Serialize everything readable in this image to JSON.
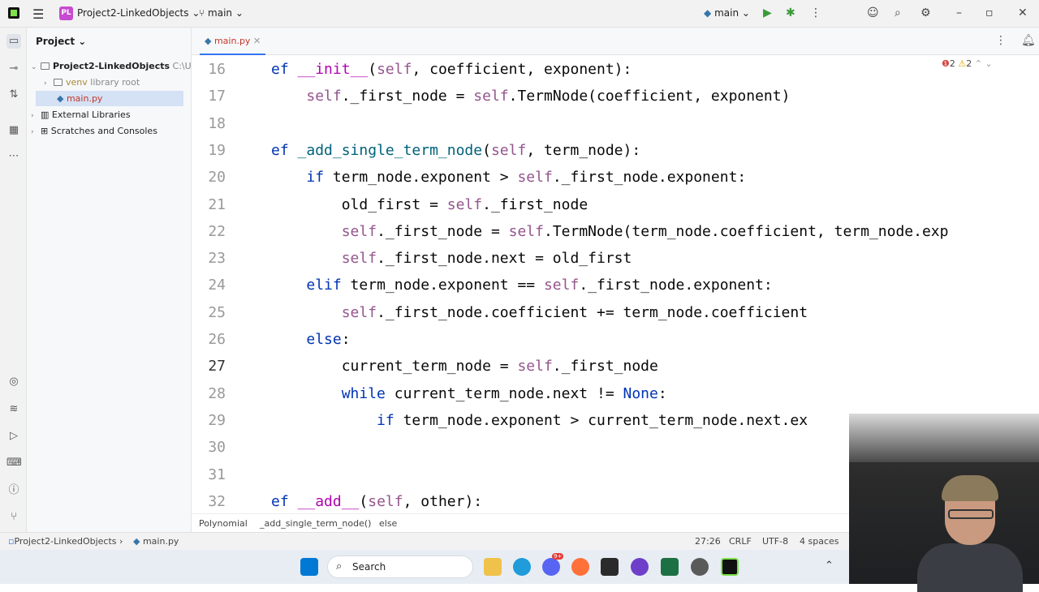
{
  "titlebar": {
    "project_badge": "PL",
    "project_name": "Project2-LinkedObjects",
    "branch": "main",
    "run_config": "main"
  },
  "sidebar": {
    "header": "Project",
    "tree": [
      {
        "label": "Project2-LinkedObjects",
        "path": "C:\\Us"
      },
      {
        "label": "venv",
        "note": "library root"
      },
      {
        "label": "main.py"
      },
      {
        "label": "External Libraries"
      },
      {
        "label": "Scratches and Consoles"
      }
    ]
  },
  "tabs": [
    {
      "label": "main.py"
    }
  ],
  "inspections": {
    "errors": "2",
    "warnings": "2"
  },
  "editor": {
    "line_numbers": [
      "16",
      "17",
      "18",
      "19",
      "20",
      "21",
      "22",
      "23",
      "24",
      "25",
      "26",
      "27",
      "28",
      "29",
      "30",
      "31",
      "32"
    ],
    "lines": [
      "ef __init__(self, coefficient, exponent):",
      "    self._first_node = self.TermNode(coefficient, exponent)",
      "",
      "ef _add_single_term_node(self, term_node):",
      "    if term_node.exponent > self._first_node.exponent:",
      "        old_first = self._first_node",
      "        self._first_node = self.TermNode(term_node.coefficient, term_node.exp",
      "        self._first_node.next = old_first",
      "    elif term_node.exponent == self._first_node.exponent:",
      "        self._first_node.coefficient += term_node.coefficient",
      "    else:",
      "        current_term_node = self._first_node",
      "        while current_term_node.next != None:",
      "            if term_node.exponent > current_term_node.next.ex",
      "",
      "",
      "ef __add__(self, other):"
    ]
  },
  "breadcrumb": [
    "Polynomial",
    "_add_single_term_node()",
    "else"
  ],
  "status": {
    "path_project": "Project2-LinkedObjects",
    "path_file": "main.py",
    "position": "27:26",
    "line_sep": "CRLF",
    "encoding": "UTF-8",
    "indent": "4 spaces"
  },
  "taskbar": {
    "search_label": "Search",
    "discord_badge": "9+"
  }
}
